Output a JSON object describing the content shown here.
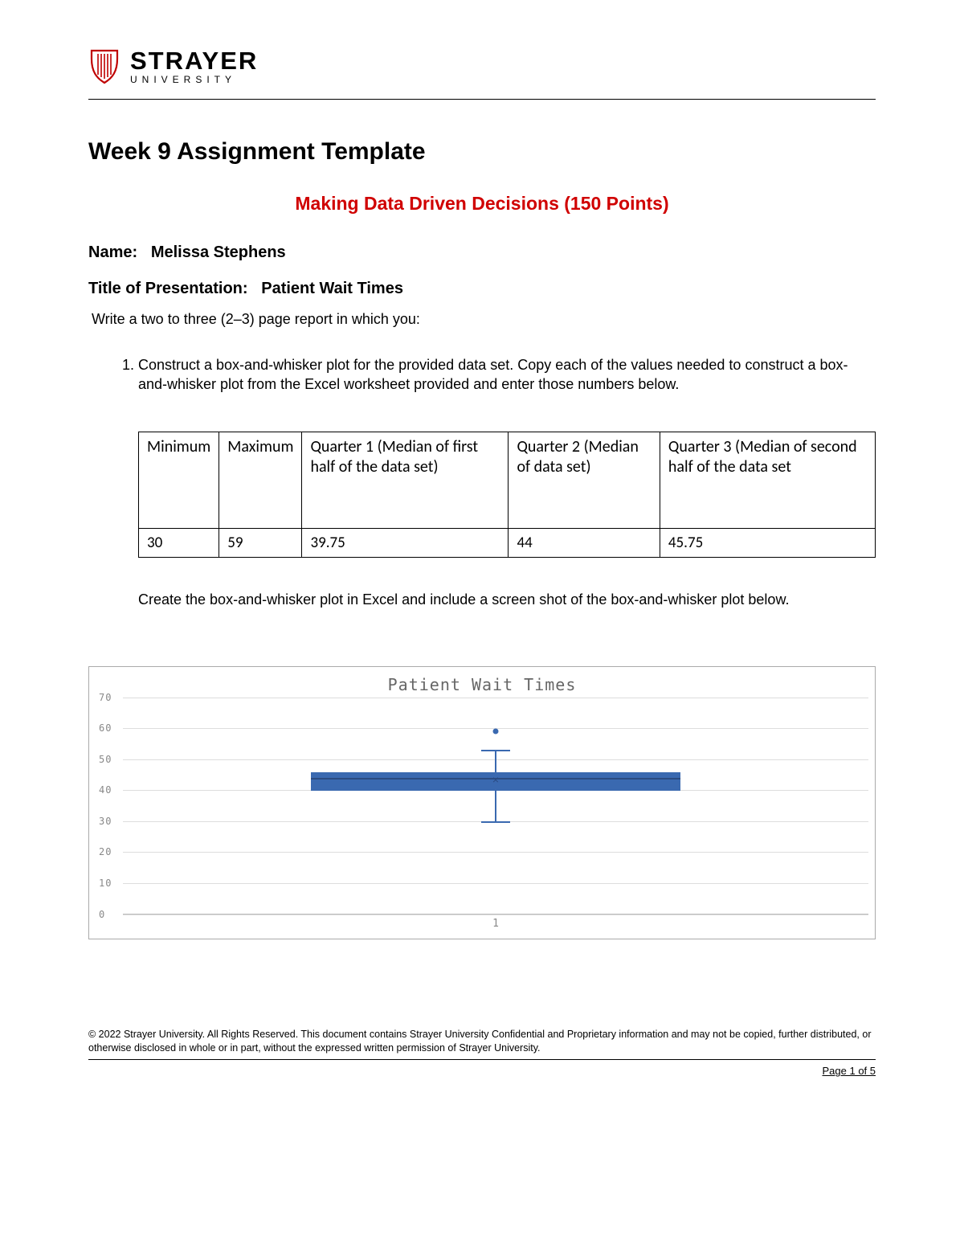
{
  "brand": {
    "name": "STRAYER",
    "sub": "UNIVERSITY"
  },
  "title": "Week 9 Assignment Template",
  "subtitle": "Making Data Driven Decisions (150 Points)",
  "name_label": "Name:",
  "name_value": "Melissa Stephens",
  "presentation_label": "Title of Presentation:",
  "presentation_value": "Patient Wait Times",
  "prompt": "Write a two to three (2–3) page report in which you:",
  "list": {
    "item1": "Construct a box-and-whisker plot for the provided data set. Copy each of the values needed to construct a box-and-whisker plot from the Excel worksheet provided and enter those numbers below."
  },
  "table": {
    "headers": [
      "Minimum",
      "Maximum",
      "Quarter 1 (Median of first half of the data set)",
      "Quarter 2 (Median of data set)",
      "Quarter 3 (Median of second half of the data set"
    ],
    "row": [
      "30",
      "59",
      "39.75",
      "44",
      "45.75"
    ]
  },
  "after_table": "Create the box-and-whisker plot in Excel and include a screen shot of the box-and-whisker plot below.",
  "chart_data": {
    "type": "boxplot",
    "title": "Patient Wait Times",
    "x_labels": [
      "1"
    ],
    "y_ticks": [
      0,
      10,
      20,
      30,
      40,
      50,
      60,
      70
    ],
    "ylim": [
      0,
      70
    ],
    "series": [
      {
        "name": "1",
        "min": 30,
        "q1": 39.75,
        "median": 44,
        "q3": 45.75,
        "whisker_high": 53,
        "outliers": [
          59
        ],
        "mean": 43
      }
    ]
  },
  "footer": "© 2022 Strayer University. All Rights Reserved. This document contains Strayer University Confidential and Proprietary information and may not be copied, further distributed, or otherwise disclosed in whole or in part, without the expressed written permission of Strayer University.",
  "page_info": "Page 1 of 5"
}
